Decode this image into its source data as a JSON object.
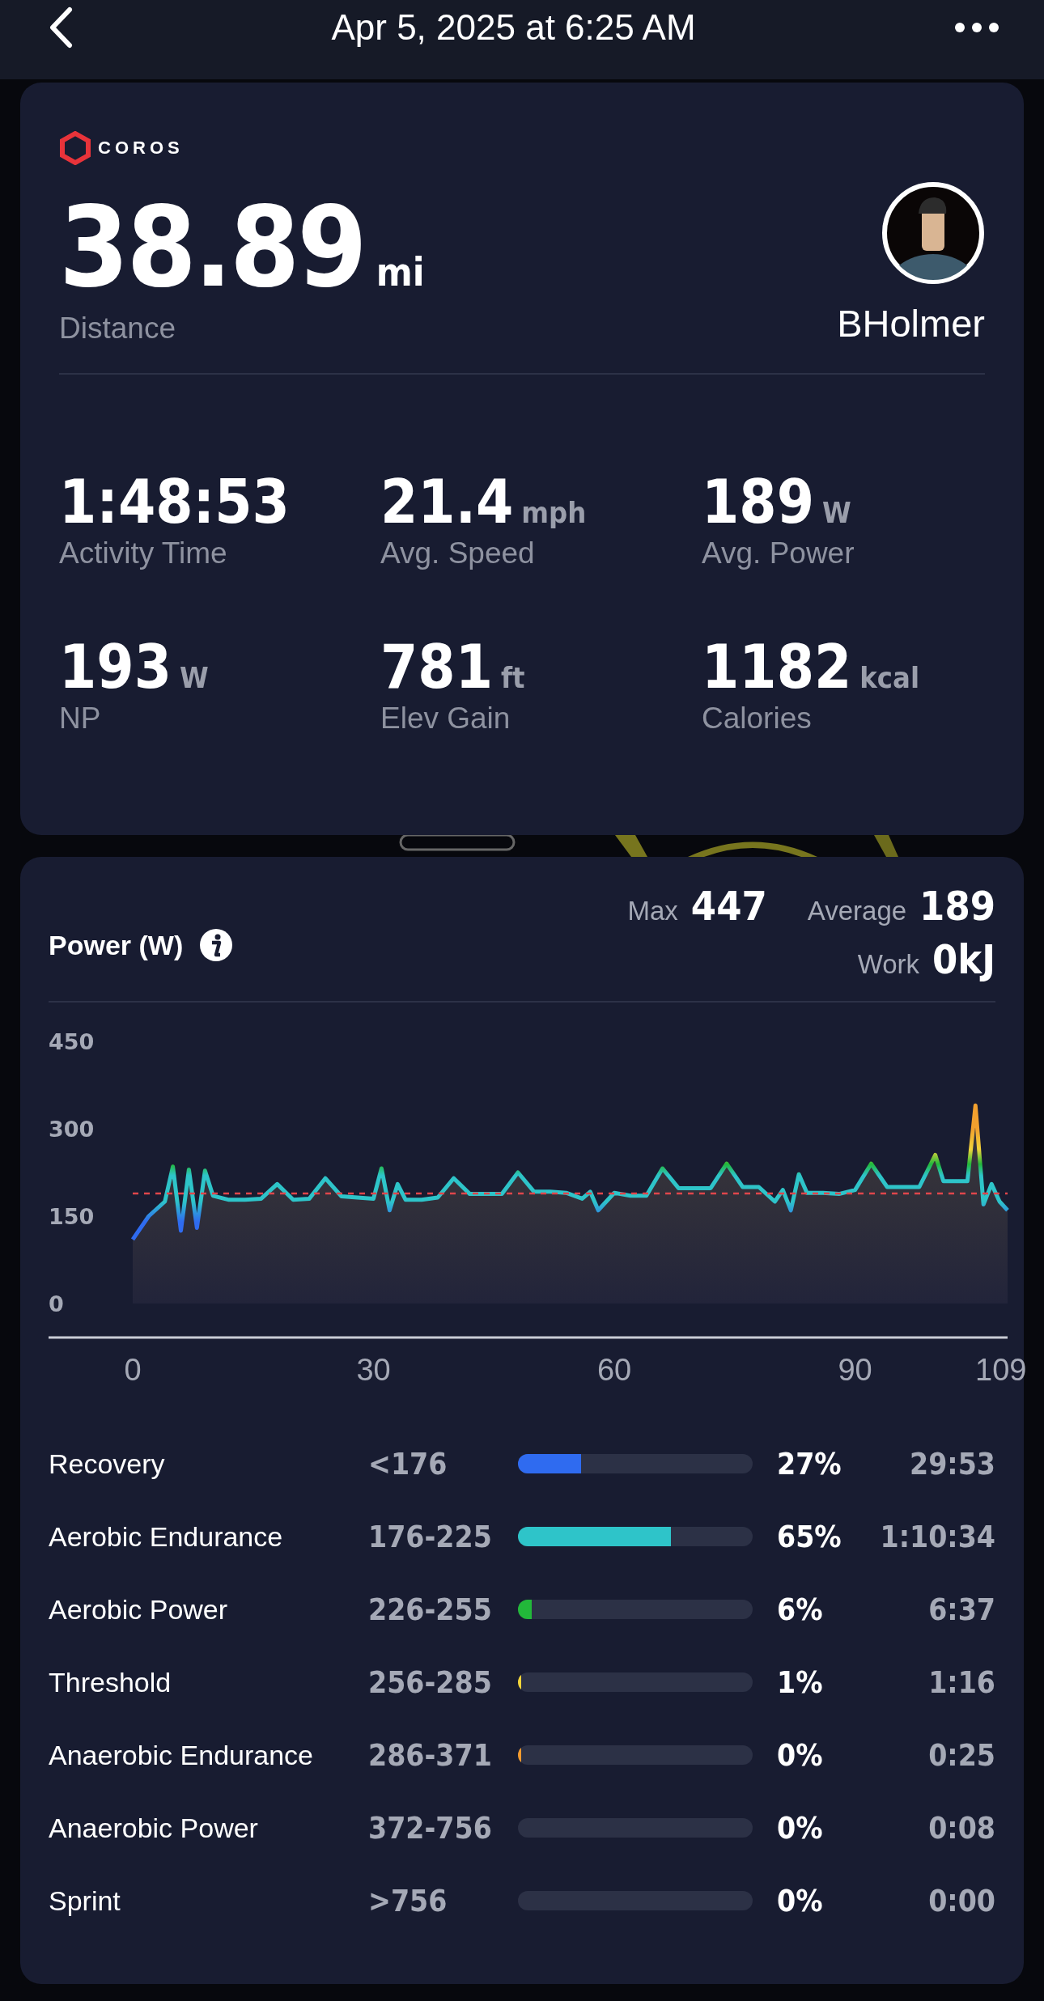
{
  "header": {
    "title": "Apr 5, 2025 at 6:25 AM"
  },
  "summary": {
    "brand": "COROS",
    "distance": {
      "value": "38.89",
      "unit": "mi",
      "label": "Distance"
    },
    "athlete": "BHolmer",
    "stats": [
      {
        "value": "1:48:53",
        "label": "Activity Time"
      },
      {
        "value": "21.4",
        "unit": "mph",
        "label": "Avg. Speed"
      },
      {
        "value": "189",
        "unit": "W",
        "label": "Avg. Power"
      },
      {
        "value": "193",
        "unit": "W",
        "label": "NP"
      },
      {
        "value": "781",
        "unit": "ft",
        "label": "Elev Gain"
      },
      {
        "value": "1182",
        "unit": "kcal",
        "label": "Calories"
      }
    ]
  },
  "power": {
    "title": "Power (W)",
    "summary": [
      {
        "label": "Max",
        "value": "447"
      },
      {
        "label": "Average",
        "value": "189"
      },
      {
        "label": "Work",
        "value": "0kJ"
      }
    ],
    "chart_data": {
      "type": "area",
      "x": [
        0,
        2,
        4,
        5,
        6,
        7,
        8,
        9,
        10,
        12,
        14,
        16,
        18,
        20,
        22,
        24,
        26,
        28,
        30,
        31,
        32,
        33,
        34,
        36,
        38,
        40,
        42,
        44,
        46,
        48,
        50,
        52,
        54,
        56,
        57,
        58,
        60,
        62,
        64,
        66,
        68,
        70,
        72,
        74,
        76,
        78,
        80,
        81,
        82,
        83,
        84,
        86,
        88,
        90,
        92,
        94,
        96,
        98,
        100,
        101,
        102,
        104,
        105,
        106,
        107,
        108,
        109
      ],
      "series": [
        {
          "color": "#2ec4c9",
          "values": [
            110,
            150,
            175,
            235,
            125,
            230,
            130,
            228,
            185,
            178,
            178,
            180,
            205,
            178,
            180,
            215,
            184,
            182,
            180,
            232,
            160,
            205,
            178,
            178,
            182,
            215,
            188,
            188,
            188,
            225,
            192,
            192,
            190,
            180,
            192,
            160,
            190,
            185,
            185,
            232,
            198,
            198,
            198,
            240,
            200,
            200,
            175,
            195,
            160,
            222,
            190,
            190,
            188,
            195,
            240,
            200,
            200,
            200,
            255,
            210,
            210,
            210,
            340,
            170,
            205,
            175,
            160
          ]
        }
      ],
      "xlim": [
        0,
        109
      ],
      "ylim": [
        0,
        450
      ],
      "xticks": [
        0,
        30,
        60,
        90,
        109
      ],
      "yticks": [
        0,
        150,
        300,
        450
      ],
      "ref_lines": [
        {
          "axis": "y",
          "value": 189,
          "color": "#e0464b"
        }
      ]
    },
    "zones": [
      {
        "name": "Recovery",
        "range": "<176",
        "level": 0.27,
        "percent": "27%",
        "time": "29:53",
        "color": "#2f6bf0"
      },
      {
        "name": "Aerobic Endurance",
        "range": "176-225",
        "level": 0.65,
        "percent": "65%",
        "time": "1:10:34",
        "color": "#2ec4c9"
      },
      {
        "name": "Aerobic Power",
        "range": "226-255",
        "level": 0.06,
        "percent": "6%",
        "time": "6:37",
        "color": "#22b83a"
      },
      {
        "name": "Threshold",
        "range": "256-285",
        "level": 0.01,
        "percent": "1%",
        "time": "1:16",
        "color": "#f2d43a"
      },
      {
        "name": "Anaerobic Endurance",
        "range": "286-371",
        "level": 0.01,
        "percent": "0%",
        "time": "0:25",
        "color": "#f29a2e"
      },
      {
        "name": "Anaerobic Power",
        "range": "372-756",
        "percent": "0%",
        "time": "0:08"
      },
      {
        "name": "Sprint",
        "range": ">756",
        "percent": "0%",
        "time": "0:00"
      }
    ]
  }
}
